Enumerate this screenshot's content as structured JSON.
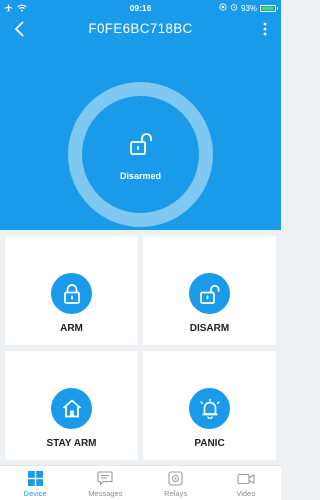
{
  "status_bar": {
    "time": "09:16",
    "battery_percent": "93%",
    "battery_level": 0.93
  },
  "header": {
    "title": "F0FE6BC718BC"
  },
  "device": {
    "state": "Disarmed"
  },
  "actions": [
    {
      "label": "ARM",
      "icon": "lock-closed-icon"
    },
    {
      "label": "DISARM",
      "icon": "lock-open-icon"
    },
    {
      "label": "STAY ARM",
      "icon": "home-icon"
    },
    {
      "label": "PANIC",
      "icon": "alarm-bell-icon"
    }
  ],
  "tabs": [
    {
      "label": "Device",
      "icon": "grid-icon",
      "active": true
    },
    {
      "label": "Messages",
      "icon": "message-icon",
      "active": false
    },
    {
      "label": "Relays",
      "icon": "relay-icon",
      "active": false
    },
    {
      "label": "Video",
      "icon": "video-icon",
      "active": false
    }
  ],
  "colors": {
    "primary": "#1a9bea",
    "ring": "#7ec8f2",
    "background": "#eef1f4"
  }
}
